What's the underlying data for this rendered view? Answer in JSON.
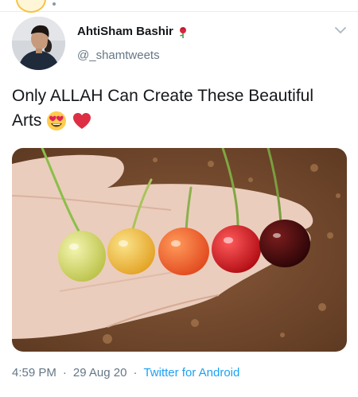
{
  "user": {
    "display_name": "AhtiSham Bashir",
    "handle": "@_shamtweets",
    "avatar_icon": "profile-photo",
    "name_emoji_icon": "rose-icon"
  },
  "tweet": {
    "text_line1": "Only ALLAH Can Create These Beautiful",
    "text_line2_word": "Arts",
    "emojis": [
      "heart-eyes-emoji",
      "red-heart-emoji"
    ],
    "media_icon": "photo-cherries-on-hand"
  },
  "meta": {
    "time": "4:59 PM",
    "separator": "·",
    "date": "29 Aug 20",
    "source": "Twitter for Android"
  },
  "colors": {
    "link": "#1da1f2",
    "secondary_text": "#657786",
    "primary_text": "#14171a"
  }
}
